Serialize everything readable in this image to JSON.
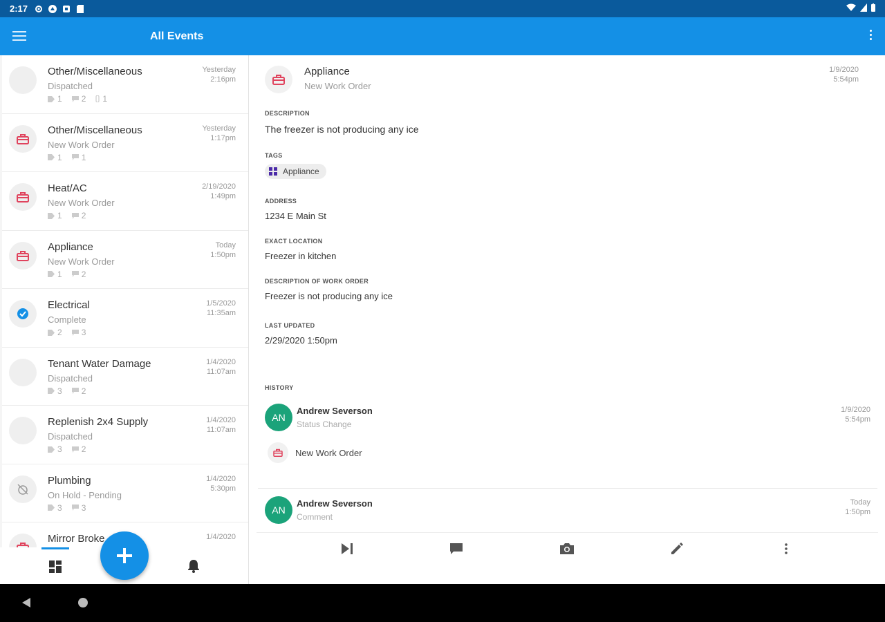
{
  "status_bar": {
    "time": "2:17"
  },
  "app_bar": {
    "title": "All Events",
    "menu_icon": "hamburger-icon",
    "more_icon": "more-vert-icon"
  },
  "events": [
    {
      "name": "Other/Miscellaneous",
      "status": "Dispatched",
      "date1": "Yesterday",
      "date2": "2:16pm",
      "icon": "empty",
      "tags": "1",
      "comments": "2",
      "attachments": "1"
    },
    {
      "name": "Other/Miscellaneous",
      "status": "New Work Order",
      "date1": "Yesterday",
      "date2": "1:17pm",
      "icon": "toolbox",
      "tags": "1",
      "comments": "1",
      "attachments": ""
    },
    {
      "name": "Heat/AC",
      "status": "New Work Order",
      "date1": "2/19/2020",
      "date2": "1:49pm",
      "icon": "toolbox",
      "tags": "1",
      "comments": "2",
      "attachments": ""
    },
    {
      "name": "Appliance",
      "status": "New Work Order",
      "date1": "Today",
      "date2": "1:50pm",
      "icon": "toolbox",
      "tags": "1",
      "comments": "2",
      "attachments": ""
    },
    {
      "name": "Electrical",
      "status": "Complete",
      "date1": "1/5/2020",
      "date2": "11:35am",
      "icon": "check",
      "tags": "2",
      "comments": "3",
      "attachments": ""
    },
    {
      "name": "Tenant Water Damage",
      "status": "Dispatched",
      "date1": "1/4/2020",
      "date2": "11:07am",
      "icon": "empty",
      "tags": "3",
      "comments": "2",
      "attachments": ""
    },
    {
      "name": "Replenish 2x4 Supply",
      "status": "Dispatched",
      "date1": "1/4/2020",
      "date2": "11:07am",
      "icon": "empty",
      "tags": "3",
      "comments": "2",
      "attachments": ""
    },
    {
      "name": "Plumbing",
      "status": "On Hold - Pending",
      "date1": "1/4/2020",
      "date2": "5:30pm",
      "icon": "alarm-off",
      "tags": "3",
      "comments": "3",
      "attachments": ""
    },
    {
      "name": "Mirror Broke",
      "status": "",
      "date1": "1/4/2020",
      "date2": "",
      "icon": "toolbox",
      "tags": "",
      "comments": "",
      "attachments": ""
    }
  ],
  "detail": {
    "title": "Appliance",
    "subtitle": "New Work Order",
    "date1": "1/9/2020",
    "date2": "5:54pm",
    "description_label": "DESCRIPTION",
    "description": "The freezer is not producing any ice",
    "tags_label": "TAGS",
    "tag": "Appliance",
    "address_label": "ADDRESS",
    "address": "1234 E Main St",
    "exact_location_label": "EXACT LOCATION",
    "exact_location": "Freezer in kitchen",
    "work_order_desc_label": "DESCRIPTION OF WORK ORDER",
    "work_order_desc": "Freezer is not producing any ice",
    "last_updated_label": "LAST UPDATED",
    "last_updated": "2/29/2020 1:50pm",
    "history_label": "HISTORY",
    "history": [
      {
        "initials": "AN",
        "who": "Andrew Severson",
        "what": "Status Change",
        "date1": "1/9/2020",
        "date2": "5:54pm",
        "sub": "New Work Order"
      },
      {
        "initials": "AN",
        "who": "Andrew Severson",
        "what": "Comment",
        "date1": "Today",
        "date2": "1:50pm"
      }
    ]
  },
  "colors": {
    "primary": "#1490e6",
    "status_bar": "#0a5a9c",
    "toolbox": "#e0435d",
    "avatar": "#1ba37a",
    "tag_icon": "#4b2aa8"
  }
}
